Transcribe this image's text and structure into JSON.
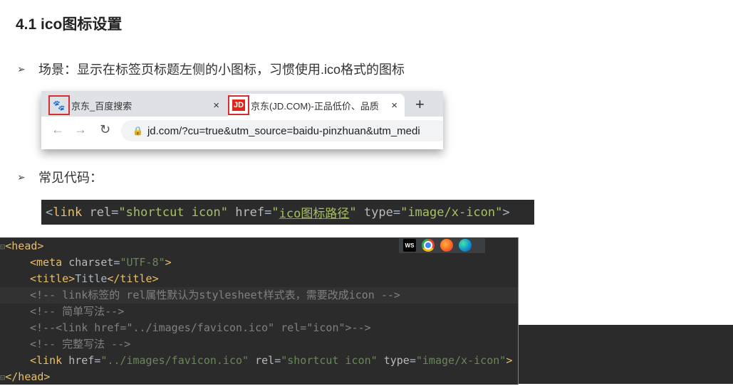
{
  "slide": {
    "title": "4.1 ico图标设置",
    "bullet1": "场景：显示在标签页标题左侧的小图标，习惯使用.ico格式的图标",
    "bullet2": "常见代码："
  },
  "browser": {
    "tab1_title": "京东_百度搜索",
    "tab1_favicon": "baidu-paw-icon",
    "tab2_title": "京东(JD.COM)-正品低价、品质",
    "tab2_favicon": "JD",
    "close": "×",
    "new_tab": "+",
    "url": "jd.com/?cu=true&utm_source=baidu-pinzhuan&utm_medi"
  },
  "snippet": {
    "open": "<",
    "tag": "link",
    "attr1": "rel",
    "val1": "\"shortcut icon\"",
    "attr2": "href",
    "val2_q1": "\"",
    "val2": "ico图标路径",
    "val2_q2": "\"",
    "attr3": "type",
    "val3": "\"image/x-icon\"",
    "close": ">"
  },
  "editor": {
    "lines": [
      {
        "tag_open": "<head>"
      },
      {
        "a": "<meta ",
        "b": "charset",
        "c": "=",
        "d": "\"UTF-8\"",
        "e": ">"
      },
      {
        "a": "<title>",
        "b": "Title",
        "c": "</title>"
      },
      {
        "comment": "<!-- link标签的 rel属性默认为stylesheet样式表，需要改成icon -->"
      },
      {
        "comment": "<!-- 简单写法-->"
      },
      {
        "comment": "<!--<link href=\"../images/favicon.ico\" rel=\"icon\">-->"
      },
      {
        "comment": "<!-- 完整写法 -->"
      },
      {
        "a": "<link ",
        "b": "href",
        "c": "=",
        "d": "\"../images/favicon.ico\"",
        "b2": " rel",
        "c2": "=",
        "d2": "\"shortcut icon\"",
        "b3": " type",
        "c3": "=",
        "d3": "\"image/x-icon\"",
        "e": ">"
      },
      {
        "tag_close": "</head>"
      }
    ],
    "browser_icons": [
      "ws-icon",
      "chrome-icon",
      "firefox-icon",
      "edge-icon"
    ],
    "ws_label": "WS"
  }
}
